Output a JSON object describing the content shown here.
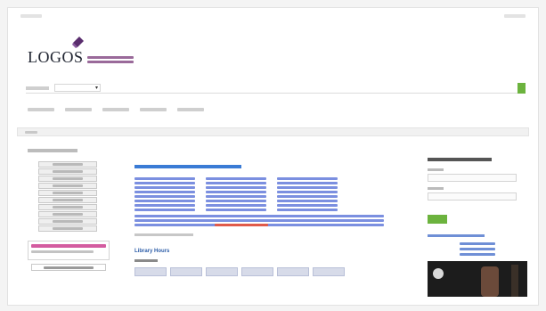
{
  "brand": {
    "name": "LOGOS",
    "subtitle_en": "",
    "subtitle_zh": ""
  },
  "topbar": {
    "left": "",
    "right": ""
  },
  "search": {
    "label": "",
    "scope": "",
    "placeholder": "",
    "button_label": ""
  },
  "nav": [
    {
      "label": ""
    },
    {
      "label": ""
    },
    {
      "label": ""
    },
    {
      "label": ""
    },
    {
      "label": ""
    }
  ],
  "breadcrumb": {
    "home": ""
  },
  "sidebar": {
    "title": "",
    "items": [
      {
        "label": ""
      },
      {
        "label": ""
      },
      {
        "label": ""
      },
      {
        "label": ""
      },
      {
        "label": ""
      },
      {
        "label": ""
      },
      {
        "label": ""
      },
      {
        "label": ""
      },
      {
        "label": ""
      },
      {
        "label": ""
      }
    ],
    "promo": {
      "headline": "",
      "subline": "",
      "link": ""
    }
  },
  "main": {
    "heading": "",
    "link_columns": [
      {
        "links": [
          "",
          "",
          "",
          "",
          "",
          "",
          "",
          ""
        ]
      },
      {
        "links": [
          "",
          "",
          "",
          "",
          "",
          "",
          "",
          ""
        ]
      },
      {
        "links": [
          "",
          "",
          "",
          "",
          "",
          "",
          "",
          ""
        ]
      }
    ],
    "extra_links": [
      "",
      "",
      ""
    ],
    "notice": "",
    "footnote": "",
    "hours": {
      "title": "Library Hours",
      "date": "",
      "cells": [
        "",
        "",
        "",
        "",
        "",
        "",
        ""
      ]
    }
  },
  "login": {
    "title": "",
    "username_label": "",
    "password_label": "",
    "button_label": "",
    "forgot_label": "",
    "links": [
      "",
      "",
      ""
    ]
  },
  "colors": {
    "accent_green": "#6cb33e",
    "link_blue": "#7b8fe0",
    "heading_blue": "#3a7bd5",
    "promo_pink": "#d35ca0",
    "notice_red": "#e05a4a"
  }
}
